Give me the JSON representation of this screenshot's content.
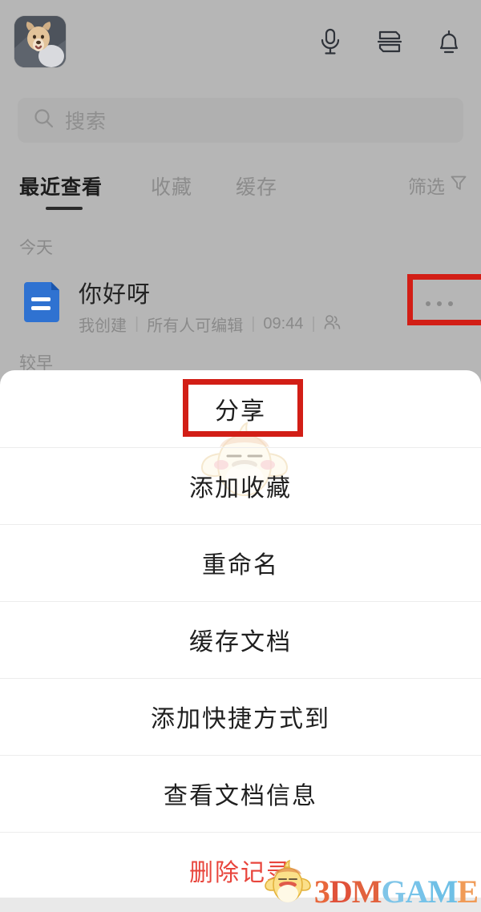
{
  "app": {
    "background_color": "#b6b6b6",
    "sheet_color": "#ffffff",
    "highlight_color": "#d21e16",
    "danger_color": "#e8453c"
  },
  "topbar": {
    "avatar_label": "用户头像",
    "icons": [
      {
        "name": "microphone-icon",
        "label": "语音"
      },
      {
        "name": "transfer-icon",
        "label": "传输"
      },
      {
        "name": "bell-icon",
        "label": "通知"
      }
    ]
  },
  "search": {
    "placeholder": "搜索",
    "value": "",
    "icon": "search-icon"
  },
  "tabs": [
    {
      "label": "最近查看",
      "active": true
    },
    {
      "label": "收藏",
      "active": false
    },
    {
      "label": "缓存",
      "active": false
    }
  ],
  "filter": {
    "label": "筛选",
    "icon": "funnel-icon"
  },
  "sections": {
    "today": "今天",
    "earlier": "较早"
  },
  "document": {
    "icon": "doc-icon",
    "title": "你好呀",
    "meta": {
      "owner": "我创建",
      "permission": "所有人可编辑",
      "time": "09:44",
      "people_icon": "people-icon",
      "separator": "|"
    },
    "more_button": "more-dots-button"
  },
  "menu": {
    "items": [
      {
        "label": "分享",
        "danger": false,
        "highlighted": true
      },
      {
        "label": "添加收藏",
        "danger": false,
        "highlighted": false
      },
      {
        "label": "重命名",
        "danger": false,
        "highlighted": false
      },
      {
        "label": "缓存文档",
        "danger": false,
        "highlighted": false
      },
      {
        "label": "添加快捷方式到",
        "danger": false,
        "highlighted": false
      },
      {
        "label": "查看文档信息",
        "danger": false,
        "highlighted": false
      },
      {
        "label": "删除记录",
        "danger": true,
        "highlighted": false
      }
    ]
  },
  "watermark": {
    "brand_letters": [
      "3",
      "D",
      "M",
      "G",
      "A",
      "M",
      "E"
    ],
    "brand_text": "3DMGAME",
    "mascot": "chick-mascot"
  }
}
